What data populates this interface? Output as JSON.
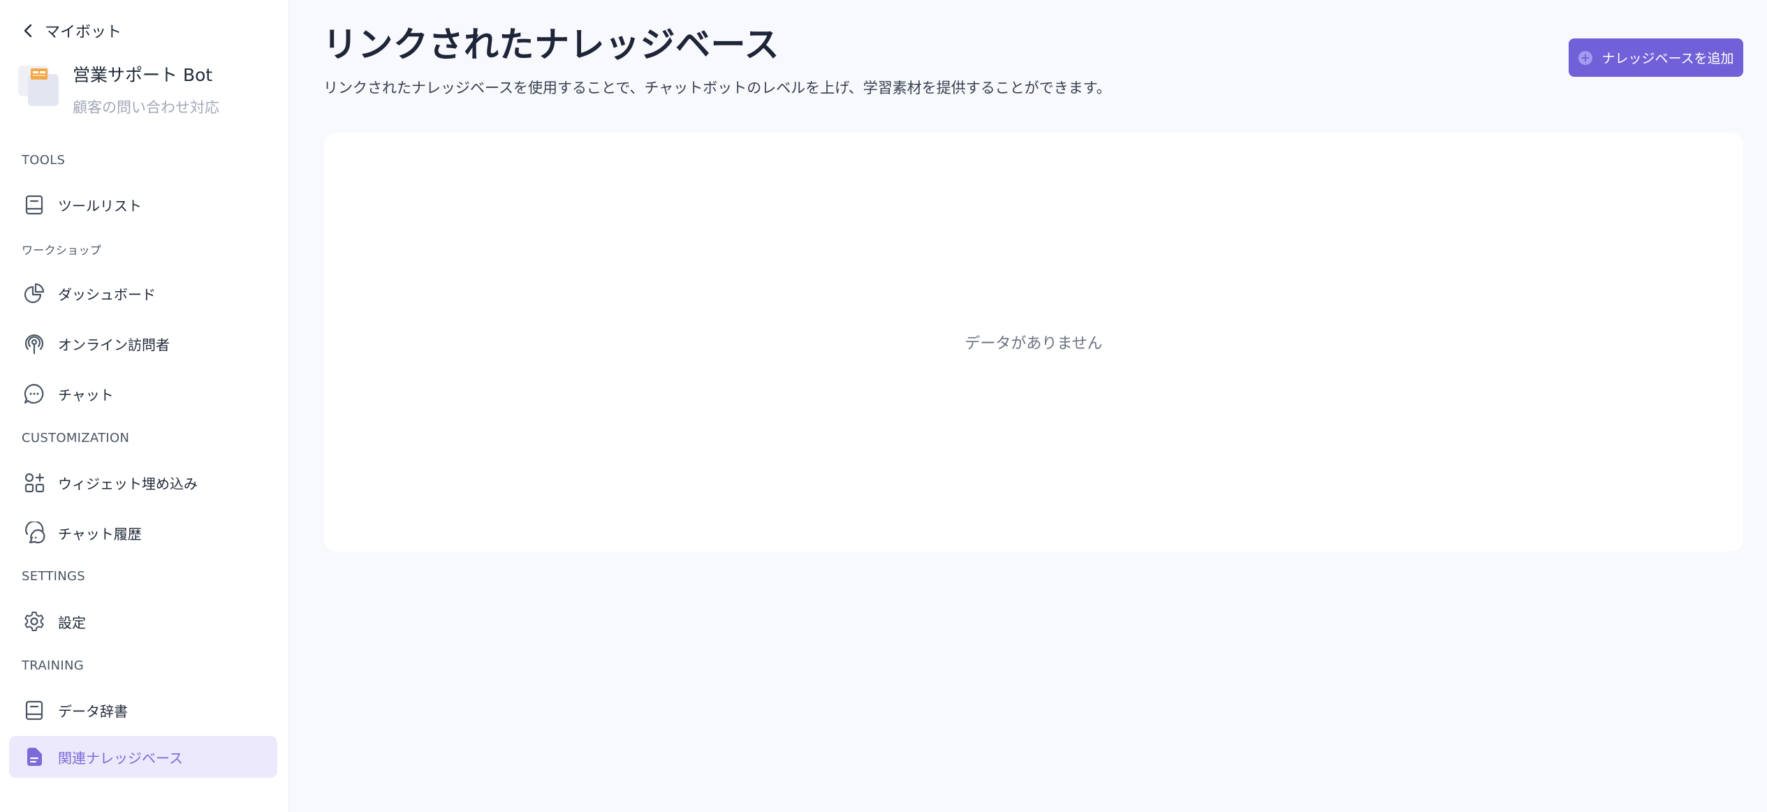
{
  "sidebar": {
    "back_label": "マイボット",
    "bot": {
      "name": "営業サポート Bot",
      "description": "顧客の問い合わせ対応"
    },
    "sections": {
      "tools": "TOOLS",
      "workshop": "ワークショップ",
      "customization": "CUSTOMIZATION",
      "settings": "SETTINGS",
      "training": "TRAINING"
    },
    "items": [
      {
        "label": "ツールリスト",
        "icon": "book-icon"
      },
      {
        "label": "ダッシュボード",
        "icon": "pie-chart-icon"
      },
      {
        "label": "オンライン訪問者",
        "icon": "broadcast-icon"
      },
      {
        "label": "チャット",
        "icon": "chat-bubble-icon"
      },
      {
        "label": "ウィジェット埋め込み",
        "icon": "widgets-icon"
      },
      {
        "label": "チャット履歴",
        "icon": "chat-history-icon"
      },
      {
        "label": "設定",
        "icon": "gear-icon"
      },
      {
        "label": "データ辞書",
        "icon": "book-icon"
      },
      {
        "label": "関連ナレッジベース",
        "icon": "document-icon",
        "active": true
      }
    ]
  },
  "main": {
    "title": "リンクされたナレッジベース",
    "subtitle": "リンクされたナレッジベースを使用することで、チャットボットのレベルを上げ、学習素材を提供することができます。",
    "add_button_label": "ナレッジベースを追加",
    "empty_text": "データがありません"
  },
  "colors": {
    "accent": "#7061d8",
    "active_bg": "#ece9fc",
    "active_text": "#7c6ad9",
    "page_bg": "#f8f9fc"
  }
}
